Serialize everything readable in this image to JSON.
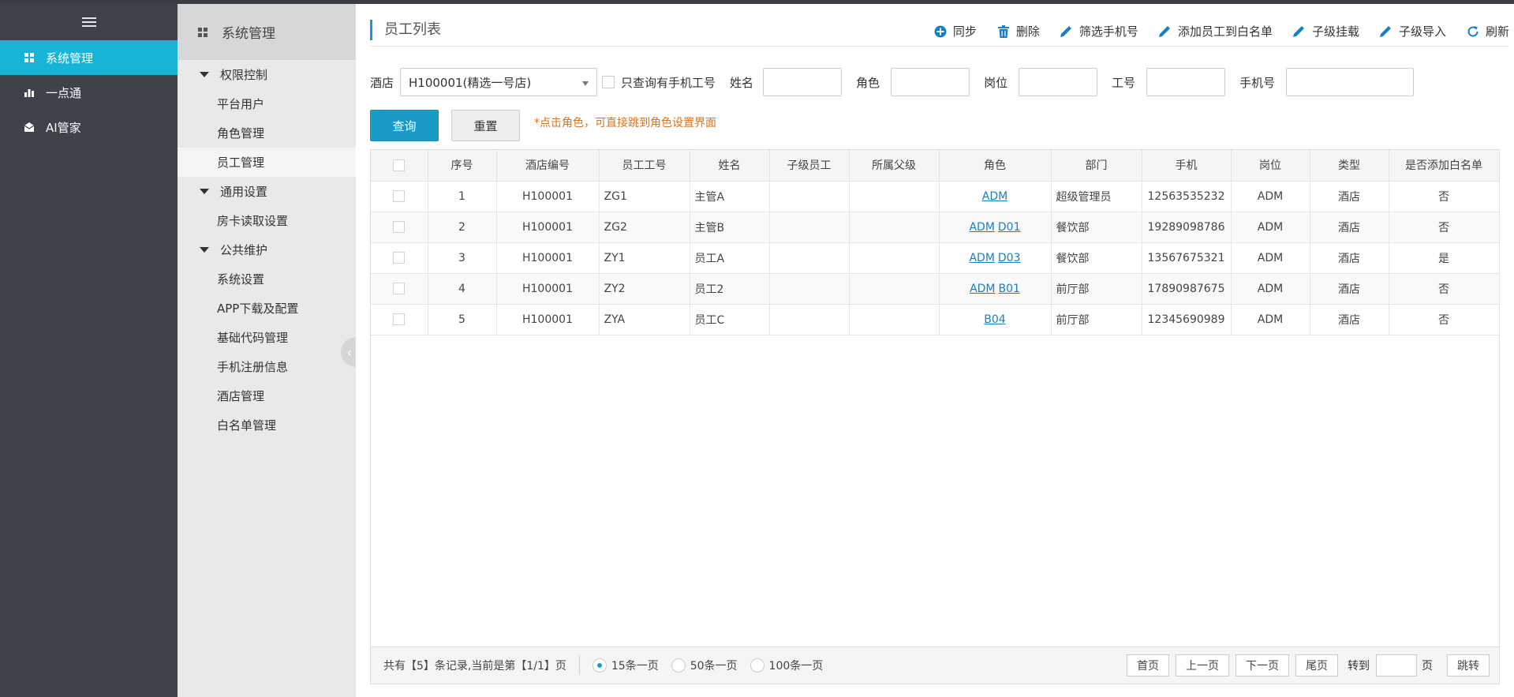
{
  "leftnav": {
    "items": [
      {
        "label": "系统管理",
        "icon": "grid-icon",
        "active": true
      },
      {
        "label": "一点通",
        "icon": "bar-chart-icon",
        "active": false
      },
      {
        "label": "AI管家",
        "icon": "mail-icon",
        "active": false
      }
    ]
  },
  "subnav": {
    "header": "系统管理",
    "groups": [
      {
        "label": "权限控制",
        "items": [
          "平台用户",
          "角色管理",
          "员工管理"
        ]
      },
      {
        "label": "通用设置",
        "items": [
          "房卡读取设置"
        ]
      },
      {
        "label": "公共维护",
        "items": [
          "系统设置",
          "APP下载及配置",
          "基础代码管理",
          "手机注册信息",
          "酒店管理",
          "白名单管理"
        ]
      }
    ]
  },
  "main": {
    "title": "员工列表",
    "toolbar": [
      {
        "label": "同步",
        "icon": "plus-circle-icon"
      },
      {
        "label": "删除",
        "icon": "trash-icon"
      },
      {
        "label": "筛选手机号",
        "icon": "pencil-icon"
      },
      {
        "label": "添加员工到白名单",
        "icon": "pencil-icon"
      },
      {
        "label": "子级挂载",
        "icon": "pencil-icon"
      },
      {
        "label": "子级导入",
        "icon": "pencil-icon"
      },
      {
        "label": "刷新",
        "icon": "refresh-icon"
      }
    ],
    "filters": {
      "hotel_label": "酒店",
      "hotel_value": "H100001(精选一号店)",
      "only_phone_label": "只查询有手机工号",
      "name_label": "姓名",
      "role_label": "角色",
      "post_label": "岗位",
      "empno_label": "工号",
      "phone_label": "手机号"
    },
    "query_label": "查询",
    "reset_label": "重置",
    "hint": "*点击角色，可直接跳到角色设置界面",
    "table": {
      "columns": [
        "",
        "序号",
        "酒店编号",
        "员工工号",
        "姓名",
        "子级员工",
        "所属父级",
        "角色",
        "部门",
        "手机",
        "岗位",
        "类型",
        "是否添加白名单"
      ],
      "rows": [
        {
          "no": "1",
          "hotel": "H100001",
          "empno": "ZG1",
          "name": "主管A",
          "child": "",
          "parent": "",
          "roles": [
            "ADM"
          ],
          "dept": "超级管理员",
          "phone": "12563535232",
          "post": "ADM",
          "type": "酒店",
          "whitelist": "否"
        },
        {
          "no": "2",
          "hotel": "H100001",
          "empno": "ZG2",
          "name": "主管B",
          "child": "",
          "parent": "",
          "roles": [
            "ADM",
            "D01"
          ],
          "dept": "餐饮部",
          "phone": "19289098786",
          "post": "ADM",
          "type": "酒店",
          "whitelist": "否"
        },
        {
          "no": "3",
          "hotel": "H100001",
          "empno": "ZY1",
          "name": "员工A",
          "child": "",
          "parent": "",
          "roles": [
            "ADM",
            "D03"
          ],
          "dept": "餐饮部",
          "phone": "13567675321",
          "post": "ADM",
          "type": "酒店",
          "whitelist": "是"
        },
        {
          "no": "4",
          "hotel": "H100001",
          "empno": "ZY2",
          "name": "员工2",
          "child": "",
          "parent": "",
          "roles": [
            "ADM",
            "B01"
          ],
          "dept": "前厅部",
          "phone": "17890987675",
          "post": "ADM",
          "type": "酒店",
          "whitelist": "否"
        },
        {
          "no": "5",
          "hotel": "H100001",
          "empno": "ZYA",
          "name": "员工C",
          "child": "",
          "parent": "",
          "roles": [
            "B04"
          ],
          "dept": "前厅部",
          "phone": "12345690989",
          "post": "ADM",
          "type": "酒店",
          "whitelist": "否"
        }
      ]
    },
    "pager": {
      "summary": "共有【5】条记录,当前是第【1/1】页",
      "sizes": [
        {
          "label": "15条一页",
          "selected": true
        },
        {
          "label": "50条一页",
          "selected": false
        },
        {
          "label": "100条一页",
          "selected": false
        }
      ],
      "first": "首页",
      "prev": "上一页",
      "next": "下一页",
      "last": "尾页",
      "goto_label": "转到",
      "page_unit": "页",
      "jump": "跳转"
    }
  },
  "colors": {
    "accent": "#18b4d6",
    "primary_button": "#1a9bc5",
    "hint": "#d9751b",
    "nav_bg": "#3f424b"
  }
}
